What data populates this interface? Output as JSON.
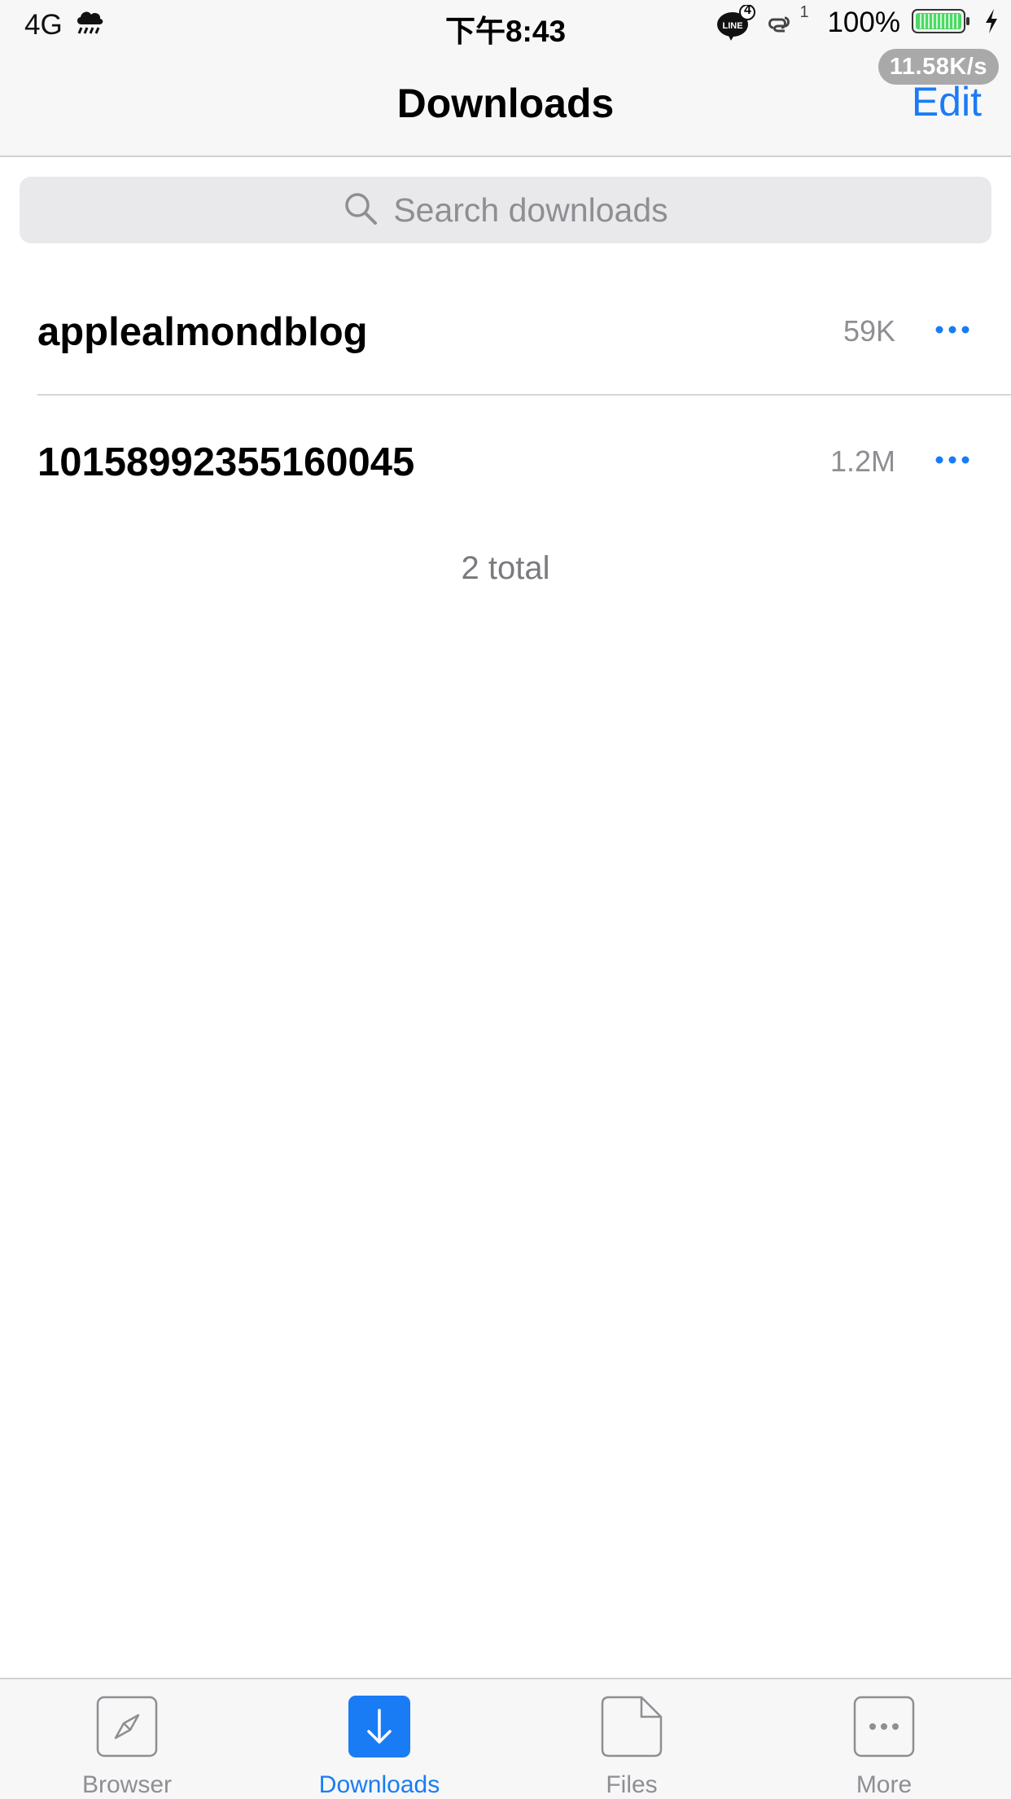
{
  "status_bar": {
    "carrier": "4G",
    "time": "下午8:43",
    "line_badge": "4",
    "link_badge": "1",
    "battery": "100%",
    "net_speed": "11.58K/s",
    "weather_icon": "rain-cloud-icon"
  },
  "nav": {
    "title": "Downloads",
    "edit_label": "Edit"
  },
  "search": {
    "placeholder": "Search downloads"
  },
  "downloads": [
    {
      "name": "applealmondblog",
      "size": "59K"
    },
    {
      "name": "10158992355160045",
      "size": "1.2M"
    }
  ],
  "total_label": "2 total",
  "tabs": [
    {
      "label": "Browser",
      "icon": "compass-icon"
    },
    {
      "label": "Downloads",
      "icon": "download-arrow-icon",
      "active": true
    },
    {
      "label": "Files",
      "icon": "file-icon"
    },
    {
      "label": "More",
      "icon": "ellipsis-icon"
    }
  ],
  "colors": {
    "accent": "#1a7cf5",
    "bar_background": "#f7f7f7",
    "secondary_text": "#8e8e93",
    "battery_fill": "#4cd964"
  }
}
